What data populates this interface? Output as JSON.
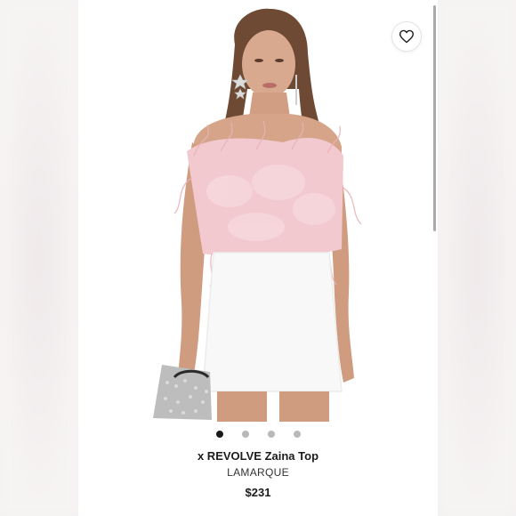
{
  "product": {
    "title": "x REVOLVE Zaina Top",
    "brand": "LAMARQUE",
    "price": "$231",
    "image_alt": "Model wearing pink feather strapless top with white mini skirt"
  },
  "carousel": {
    "total_images": 4,
    "active_index": 0
  },
  "icons": {
    "favorite": "heart-outline-icon"
  },
  "colors": {
    "feather_pink": "#f2c9cf",
    "skirt_white": "#f8f8f8",
    "active_dot": "#1a1a1a",
    "inactive_dot": "#b9b9b9"
  }
}
